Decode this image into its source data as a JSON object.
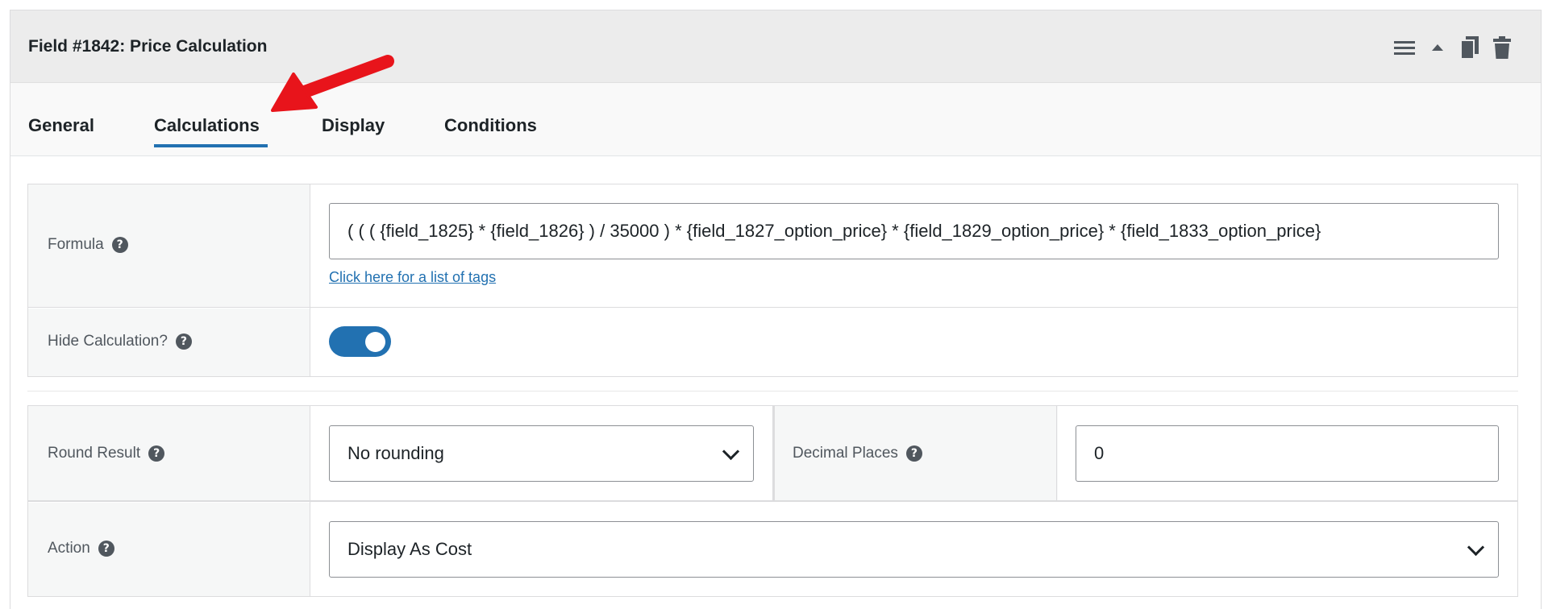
{
  "header": {
    "title": "Field #1842: Price Calculation",
    "icons": [
      "menu-icon",
      "collapse-arrow-icon",
      "duplicate-icon",
      "trash-icon"
    ]
  },
  "tabs": [
    {
      "label": "General",
      "active": false
    },
    {
      "label": "Calculations",
      "active": true
    },
    {
      "label": "Display",
      "active": false
    },
    {
      "label": "Conditions",
      "active": false
    }
  ],
  "formula": {
    "label": "Formula",
    "value": "( ( ( {field_1825} * {field_1826} ) / 35000 ) * {field_1827_option_price} * {field_1829_option_price} * {field_1833_option_price}",
    "tags_link": "Click here for a list of tags"
  },
  "hide_calculation": {
    "label": "Hide Calculation?",
    "enabled": true
  },
  "round_result": {
    "label": "Round Result",
    "selected": "No rounding"
  },
  "decimal_places": {
    "label": "Decimal Places",
    "value": "0"
  },
  "action": {
    "label": "Action",
    "selected": "Display As Cost"
  },
  "help_glyph": "?",
  "colors": {
    "accent": "#2271b1",
    "annotation_arrow": "#e8141b",
    "header_bg": "#ececec",
    "tabs_bg": "#f9f9f9",
    "label_bg": "#f6f7f7"
  }
}
